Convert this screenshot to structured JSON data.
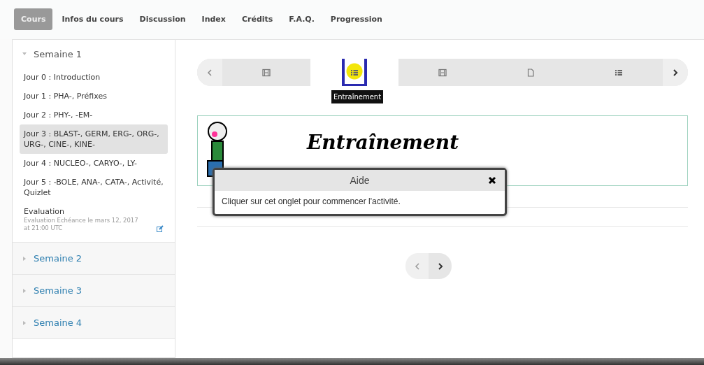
{
  "tabs": [
    {
      "label": "Cours",
      "selected": true
    },
    {
      "label": "Infos du cours",
      "selected": false
    },
    {
      "label": "Discussion",
      "selected": false
    },
    {
      "label": "Index",
      "selected": false
    },
    {
      "label": "Crédits",
      "selected": false
    },
    {
      "label": "F.A.Q.",
      "selected": false
    },
    {
      "label": "Progression",
      "selected": false
    }
  ],
  "sidebar": {
    "sections": [
      {
        "title": "Semaine 1",
        "expanded": true,
        "items": [
          {
            "label": "Jour 0 : Introduction",
            "selected": false
          },
          {
            "label": "Jour 1 : PHA-, Préfixes",
            "selected": false
          },
          {
            "label": "Jour 2 : PHY-, -EM-",
            "selected": false
          },
          {
            "label": "Jour 3 : BLAST-, GERM, ERG-, ORG-, URG-, CINE-, KINE-",
            "selected": true
          },
          {
            "label": "Jour 4 : NUCLEO-, CARYO-, LY-",
            "selected": false
          },
          {
            "label": "Jour 5 : -BOLE, ANA-, CATA-, Activité, Quizlet",
            "selected": false
          },
          {
            "label": "Evaluation",
            "selected": false,
            "note": "Evaluation Echéance le mars 12, 2017 at 21:00 UTC"
          }
        ]
      },
      {
        "title": "Semaine 2",
        "expanded": false
      },
      {
        "title": "Semaine 3",
        "expanded": false
      },
      {
        "title": "Semaine 4",
        "expanded": false
      }
    ]
  },
  "sequence": {
    "items": [
      {
        "kind": "video",
        "selected": false
      },
      {
        "kind": "problem",
        "selected": true,
        "tooltip": "Entraînement"
      },
      {
        "kind": "video",
        "selected": false
      },
      {
        "kind": "document",
        "selected": false
      },
      {
        "kind": "problem",
        "selected": false
      }
    ]
  },
  "content": {
    "title": "Entraînement"
  },
  "dialog": {
    "title": "Aide",
    "message": "Cliquer sur cet onglet pour commencer l'activité."
  }
}
